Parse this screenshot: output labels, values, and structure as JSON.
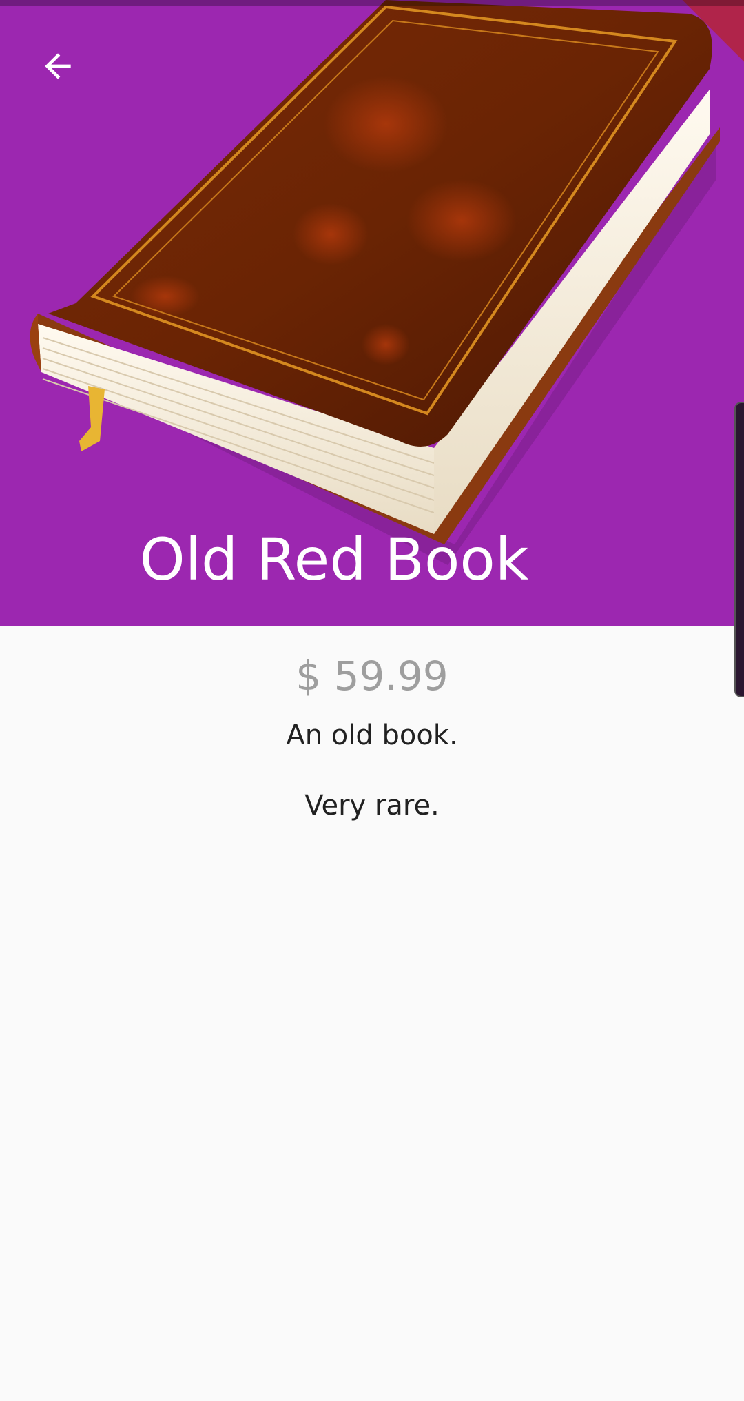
{
  "app_bar": {
    "back_icon": "arrow-back-icon"
  },
  "product": {
    "title": "Old Red Book",
    "price": "$ 59.99",
    "description_lines": [
      "An old book.",
      "Very rare."
    ]
  },
  "colors": {
    "hero_background": "#9c27b0",
    "page_background": "#fafafa",
    "title": "#ffffff",
    "price": "#9e9e9e",
    "description": "#212121"
  }
}
